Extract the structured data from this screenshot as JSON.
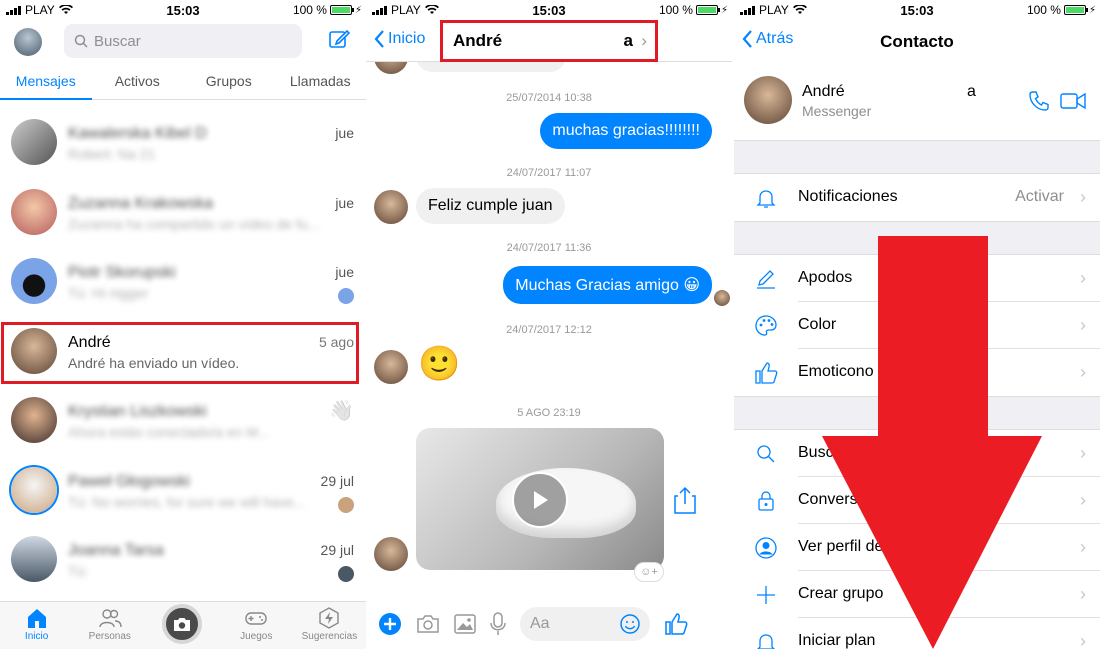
{
  "status": {
    "carrier": "PLAY",
    "time": "15:03",
    "battery": "100 %"
  },
  "inbox": {
    "search_placeholder": "Buscar",
    "tabs": [
      "Mensajes",
      "Activos",
      "Grupos",
      "Llamadas"
    ],
    "chats": [
      {
        "name": "Kawalerska Kibel D",
        "preview": "Robert: Na 21",
        "time": "jue",
        "blurred": true
      },
      {
        "name": "Zuzanna Krakowska",
        "preview": "Zuzanna ha compartido un vídeo de fu...",
        "time": "jue",
        "blurred": true
      },
      {
        "name": "Piotr Skorupski",
        "preview": "Tú: Hi nigger",
        "time": "jue",
        "blurred": true
      },
      {
        "name": "André",
        "preview": "André ha enviado un vídeo.",
        "time": "5 ago",
        "blurred": false
      },
      {
        "name": "Krystian Liszkowski",
        "preview": "Ahora estás conectado/a en M...",
        "time": "",
        "blurred": true
      },
      {
        "name": "Paweł Głogowski",
        "preview": "Tú: No worries, for sure we will have...",
        "time": "29 jul",
        "blurred": true
      },
      {
        "name": "Joanna Tarsa",
        "preview": "Tú:",
        "time": "29 jul",
        "blurred": true
      }
    ],
    "tabbar": [
      "Inicio",
      "Personas",
      "",
      "Juegos",
      "Sugerencias"
    ]
  },
  "conversation": {
    "back_label": "Inicio",
    "title": "André",
    "title_suffix": "a",
    "messages": [
      {
        "stamp": "25/07/2014 10:38",
        "text": "muchas gracias!!!!!!!!",
        "dir": "out"
      },
      {
        "stamp": "24/07/2017 11:07",
        "text": "Feliz cumple juan",
        "dir": "in"
      },
      {
        "stamp": "24/07/2017 11:36",
        "text": "Muchas Gracias amigo 😀",
        "dir": "out"
      },
      {
        "stamp": "24/07/2017 12:12",
        "text": "🙂",
        "dir": "in"
      },
      {
        "stamp": "5 AGO 23:19",
        "text": "",
        "dir": "in"
      }
    ],
    "composer_placeholder": "Aa"
  },
  "contact": {
    "back_label": "Atrás",
    "title": "Contacto",
    "name": "André",
    "name_suffix": "a",
    "subtitle": "Messenger",
    "rows": [
      {
        "label": "Notificaciones",
        "value": "Activar",
        "icon": "bell-icon"
      },
      {
        "label": "Apodos",
        "value": "",
        "icon": "pencil-icon"
      },
      {
        "label": "Color",
        "value": "",
        "icon": "palette-icon"
      },
      {
        "label": "Emoticono",
        "value": "",
        "icon": "thumbs-up-icon"
      },
      {
        "label": "Buscar en la conversación",
        "value": "",
        "icon": "search-icon"
      },
      {
        "label": "Conversaciones secretas",
        "value": "",
        "icon": "lock-icon"
      },
      {
        "label": "Ver perfil de Facebook",
        "value": "",
        "icon": "profile-icon"
      },
      {
        "label": "Crear grupo",
        "value": "",
        "icon": "plus-icon"
      },
      {
        "label": "Iniciar plan",
        "value": "",
        "icon": "bell-icon"
      }
    ]
  },
  "colors": {
    "accent": "#0084ff",
    "highlight": "#e01b24",
    "arrow": "#ec1c24"
  }
}
